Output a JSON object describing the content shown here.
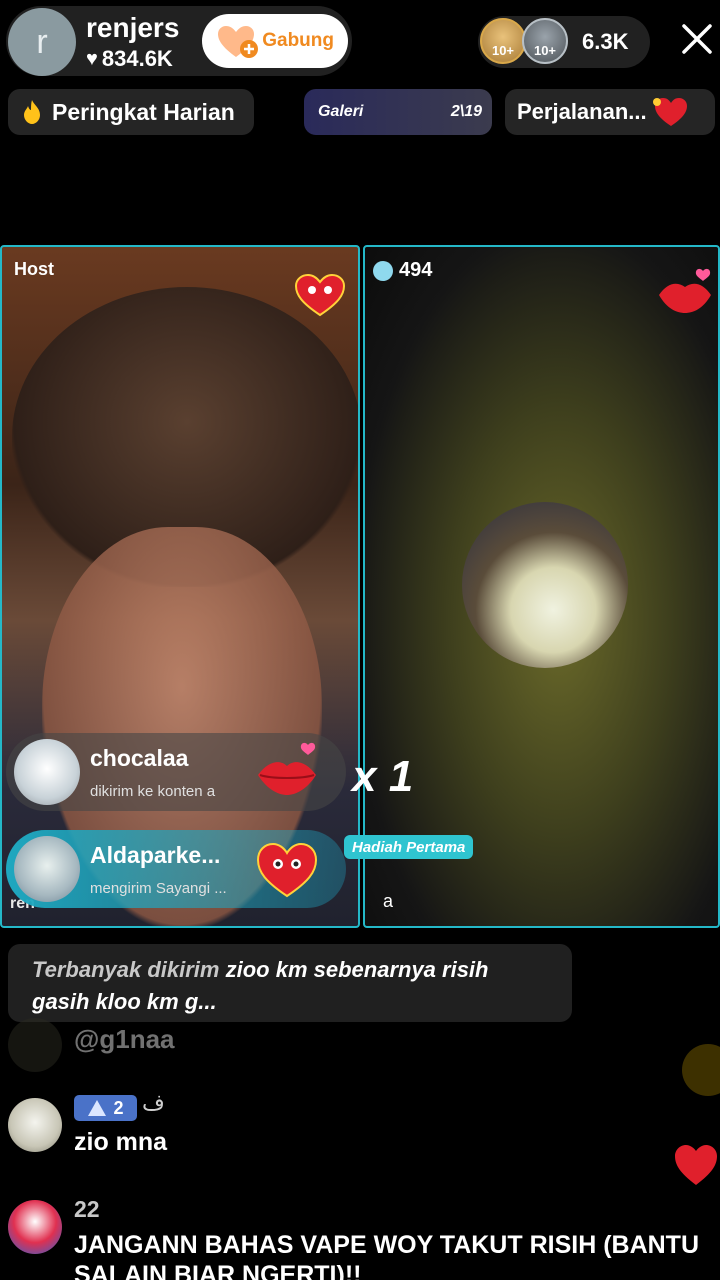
{
  "host": {
    "avatar_letter": "r",
    "name": "renjers",
    "likes": "834.6K",
    "join_label": "Gabung"
  },
  "viewers": {
    "badge1": "10+",
    "badge2": "10+",
    "count": "6.3K"
  },
  "row2": {
    "ranking_label": "Peringkat Harian",
    "gallery_label": "Galeri",
    "gallery_count": "2\\19",
    "journey_label": "Perjalanan..."
  },
  "panels": {
    "host_tag": "Host",
    "guest_score": "494",
    "guest_label": "a"
  },
  "gifts": [
    {
      "name": "chocalaa",
      "sub": "dikirim ke konten a"
    },
    {
      "name": "Aldaparke...",
      "sub": "mengirim Sayangi ..."
    }
  ],
  "combo": "x 1",
  "first_gift_label": "Hadiah Pertama",
  "host_watermark": "ren",
  "chat": {
    "top_gifter_prefix": "Terbanyak dikirim",
    "top_gifter_text": "zioo km sebenarnya risih gasih kloo km g...",
    "faded_msg": "@g1naa",
    "msg1_badge_level": "2",
    "msg1_mark": "ف",
    "msg1_text": "zio mna",
    "msg2_level": "22",
    "msg2_text": "JANGANN BAHAS VAPE WOY TAKUT RISIH (BANTU SALAIN BIAR NGERTI)!!"
  },
  "colors": {
    "accent_cyan": "#24b8c8",
    "join_orange": "#f08a20",
    "like_red": "#e0202c"
  },
  "icons": [
    "heart-icon",
    "join-heart-icon",
    "close-icon",
    "fire-icon",
    "lips-gift-icon",
    "heart-face-gift-icon",
    "diamond-icon",
    "triangle-badge-icon"
  ]
}
